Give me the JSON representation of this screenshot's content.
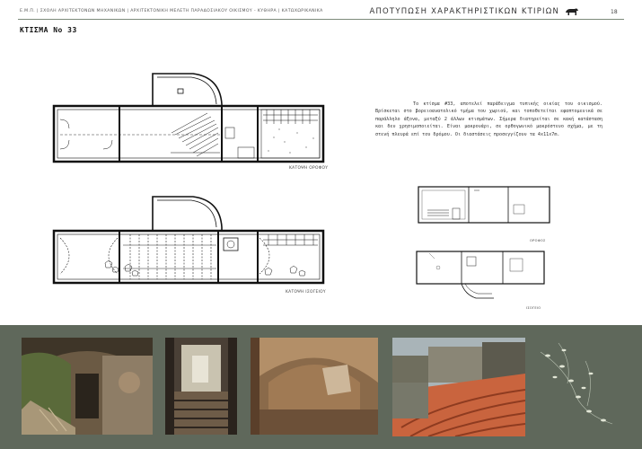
{
  "header": {
    "left_text": "Ε.Μ.Π. | ΣΧΟΛΗ ΑΡΧΙΤΕΚΤΟΝΩΝ ΜΗΧΑΝΙΚΩΝ | ΑΡΧΙΤΕΚΤΟΝΙΚΗ ΜΕΛΕΤΗ ΠΑΡΑΔΟΣΙΑΚΟΥ ΟΙΚΙΣΜΟΥ - ΚΥΘΗΡΑ | ΚΑΤΩΧΩΡΙΚΑΝΙΚΑ",
    "right_title": "ΑΠΟΤΥΠΩΣΗ ΧΑΡΑΚΤΗΡΙΣΤΙΚΩΝ ΚΤΙΡΙΩΝ",
    "icon": "animal-logo-icon",
    "page_number": "18"
  },
  "title": "ΚΤΙΣΜΑ Νο 33",
  "plans": {
    "upper_caption": "ΚΑΤΟΨΗ ΟΡΟΦΟΥ",
    "lower_caption": "ΚΑΤΟΨΗ ΙΣΟΓΕΙΟΥ",
    "small_upper_caption": "ΟΡΟΦΟΣ",
    "small_lower_caption": "ΙΣΟΓΕΙΟ"
  },
  "description": "Το κτίσμα #33, αποτελεί παράδειγμα τυπικής οικίας του οικισμού. Βρίσκεται στο βορειοανατολικό τμήμα του χωριού, και τοποθετείται εφαπτομενικά σε παράλληλο άξονα, μεταξύ 2 άλλων κτισμάτων. Σήμερα διατηρείται σε κακή κατάσταση και δεν χρησιμοποιείται. Είναι μακρονάρι, σε ορθογωνικό μακρόστενο σχήμα, με τη στενή πλευρά επί του δρόμου. Οι διαστάσεις προσεγγίζουν τα 4x11x7m.",
  "colors": {
    "band": "#5f685b",
    "header_rule": "#7d8a7a"
  }
}
